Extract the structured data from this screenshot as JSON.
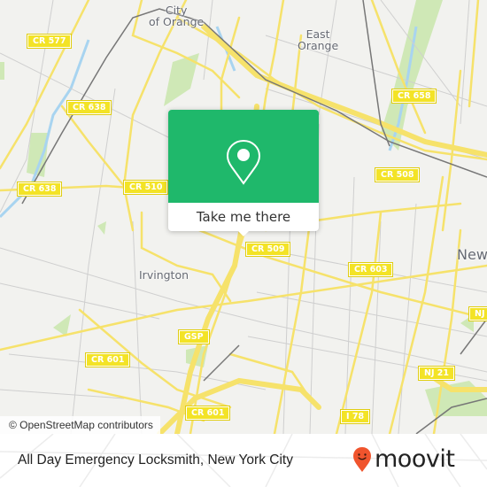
{
  "map": {
    "place_labels": [
      {
        "id": "city-of-orange",
        "lines": [
          "City",
          "of Orange"
        ]
      },
      {
        "id": "east-orange",
        "lines": [
          "East",
          "Orange"
        ]
      },
      {
        "id": "irvington",
        "lines": [
          "Irvington"
        ]
      },
      {
        "id": "newark",
        "lines": [
          "New"
        ]
      }
    ],
    "road_shields": [
      {
        "id": "cr-577",
        "label": "CR 577"
      },
      {
        "id": "cr-638-a",
        "label": "CR 638"
      },
      {
        "id": "cr-638-b",
        "label": "CR 638"
      },
      {
        "id": "cr-510",
        "label": "CR 510"
      },
      {
        "id": "cr-658",
        "label": "CR 658"
      },
      {
        "id": "cr-508",
        "label": "CR 508"
      },
      {
        "id": "cr-509",
        "label": "CR 509"
      },
      {
        "id": "cr-603",
        "label": "CR 603"
      },
      {
        "id": "gsp",
        "label": "GSP"
      },
      {
        "id": "cr-601-a",
        "label": "CR 601"
      },
      {
        "id": "cr-601-b",
        "label": "CR 601"
      },
      {
        "id": "nj-21",
        "label": "NJ 21"
      },
      {
        "id": "nj-edge",
        "label": "NJ"
      },
      {
        "id": "i-78",
        "label": "I 78"
      }
    ],
    "attribution": "© OpenStreetMap contributors",
    "colors": {
      "land": "#f2f2ef",
      "major_road": "#f6e26b",
      "minor_road": "#c8c8c8",
      "rail": "#777777",
      "park": "#cfe8b6",
      "water": "#a8d4f0"
    }
  },
  "popup": {
    "button_label": "Take me there",
    "icon": "location-pin-icon",
    "color": "#1fb86b"
  },
  "footer": {
    "title": "All Day Emergency Locksmith, New York City",
    "brand": "moovit",
    "brand_color": "#f0542d"
  }
}
